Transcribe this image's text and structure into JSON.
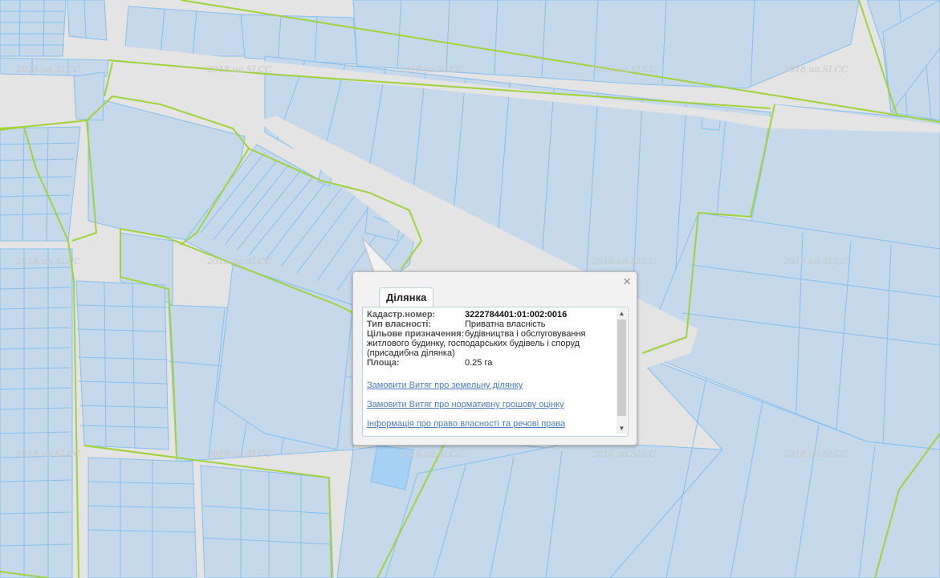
{
  "map": {
    "watermark": "2018.ua.SLCC",
    "colors": {
      "background": "#e4e4e4",
      "parcel_fill": "#c6d9ea",
      "parcel_stroke": "#85bfed",
      "block_boundary": "#9fd33d",
      "highlight_parcel": "#a6d1f4"
    }
  },
  "popup": {
    "close_icon": "×",
    "tab": "Ділянка",
    "fields": {
      "cadastral_label": "Кадастр.номер:",
      "cadastral_value": "3222784401:01:002:0016",
      "ownership_label": "Тип власності:",
      "ownership_value": "Приватна власність",
      "purpose_label": "Цільове призначення:",
      "purpose_value_line1": "будівництва і обслуговування",
      "purpose_value_rest": "житлового будинку, господарських будівель і споруд (присадибна ділянка)",
      "area_label": "Площа:",
      "area_value": "0.25 га"
    },
    "links": [
      "Замовити Витяг про земельну ділянку",
      "Замовити Витяг про нормативну грошову оцінку",
      "Інформація про право власності та речові права"
    ]
  }
}
